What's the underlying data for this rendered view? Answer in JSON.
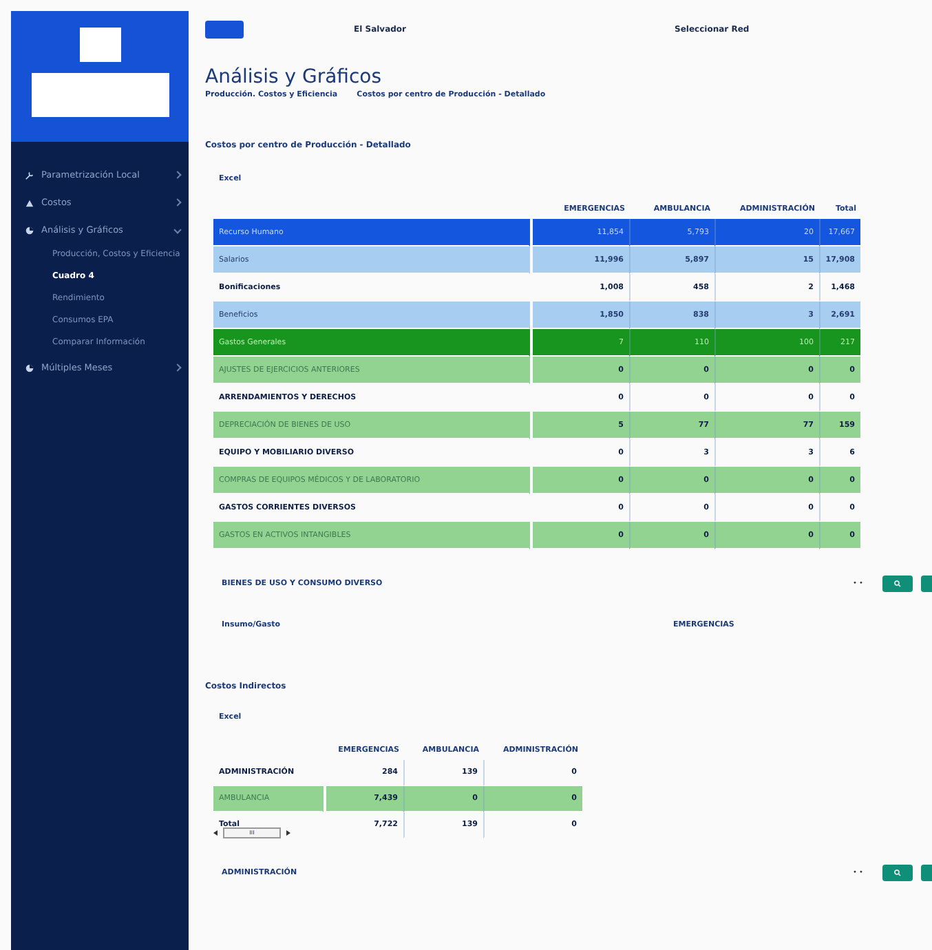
{
  "topbar": {
    "country": "El Salvador",
    "network": "Seleccionar Red"
  },
  "sidebar": {
    "items": [
      {
        "label": "Parametrización Local",
        "expanded": false
      },
      {
        "label": "Costos",
        "expanded": false
      },
      {
        "label": "Análisis y Gráficos",
        "expanded": true,
        "children": [
          {
            "label": "Producción, Costos y Eficiencia",
            "selected": false
          },
          {
            "label": "Cuadro 4",
            "selected": true
          },
          {
            "label": "Rendimiento",
            "selected": false
          },
          {
            "label": "Consumos EPA",
            "selected": false
          },
          {
            "label": "Comparar Información",
            "selected": false
          }
        ]
      },
      {
        "label": "Múltiples Meses",
        "expanded": false
      }
    ]
  },
  "page": {
    "title": "Análisis y Gráficos",
    "breadcrumb": [
      "Producción. Costos y Eficiencia",
      "Costos por centro de Producción - Detallado"
    ]
  },
  "detail": {
    "title": "Costos por centro de Producción - Detallado",
    "export": "Excel",
    "columns": [
      "EMERGENCIAS",
      "AMBULANCIA",
      "ADMINISTRACIÓN",
      "Total"
    ],
    "rows": [
      {
        "kind": "main",
        "label": "Recurso Humano",
        "cells": [
          "11,854",
          "5,793",
          "20",
          "17,667"
        ]
      },
      {
        "kind": "group",
        "label": "Salarios",
        "cells": [
          "11,996",
          "5,897",
          "15",
          "17,908"
        ]
      },
      {
        "kind": "item",
        "label": "Bonificaciones",
        "cells": [
          "1,008",
          "458",
          "2",
          "1,468"
        ]
      },
      {
        "kind": "group",
        "label": "Beneficios",
        "cells": [
          "1,850",
          "838",
          "3",
          "2,691"
        ]
      },
      {
        "kind": "main-green",
        "label": "Gastos Generales",
        "cells": [
          "7",
          "110",
          "100",
          "217"
        ]
      },
      {
        "kind": "green",
        "label": "AJUSTES DE EJERCICIOS ANTERIORES",
        "cells": [
          "0",
          "0",
          "0",
          "0"
        ]
      },
      {
        "kind": "item",
        "label": "ARRENDAMIENTOS Y DERECHOS",
        "cells": [
          "0",
          "0",
          "0",
          "0"
        ]
      },
      {
        "kind": "green",
        "label": "DEPRECIACIÓN DE BIENES DE USO",
        "cells": [
          "5",
          "77",
          "77",
          "159"
        ]
      },
      {
        "kind": "item",
        "label": "EQUIPO Y MOBILIARIO DIVERSO",
        "cells": [
          "0",
          "3",
          "3",
          "6"
        ]
      },
      {
        "kind": "green",
        "label": "COMPRAS DE EQUIPOS MÉDICOS Y DE LABORATORIO",
        "cells": [
          "0",
          "0",
          "0",
          "0"
        ]
      },
      {
        "kind": "item",
        "label": "GASTOS CORRIENTES DIVERSOS",
        "cells": [
          "0",
          "0",
          "0",
          "0"
        ]
      },
      {
        "kind": "green",
        "label": "GASTOS EN ACTIVOS INTANGIBLES",
        "cells": [
          "0",
          "0",
          "0",
          "0"
        ]
      }
    ]
  },
  "section1": {
    "title": "BIENES DE USO Y CONSUMO DIVERSO",
    "dots": "• •",
    "col_label": "Insumo/Gasto",
    "col_value": "EMERGENCIAS"
  },
  "indirect": {
    "title": "Costos Indirectos",
    "export": "Excel",
    "columns": [
      "EMERGENCIAS",
      "AMBULANCIA",
      "ADMINISTRACIÓN"
    ],
    "rows": [
      {
        "kind": "item",
        "label": "ADMINISTRACIÓN",
        "cells": [
          "284",
          "139",
          "0"
        ]
      },
      {
        "kind": "green",
        "label": "AMBULANCIA",
        "cells": [
          "7,439",
          "0",
          "0"
        ]
      },
      {
        "kind": "item",
        "label": "Total",
        "cells": [
          "7,722",
          "139",
          "0"
        ]
      }
    ],
    "scroll_grip": "III"
  },
  "section2": {
    "title": "ADMINISTRACIÓN",
    "dots": "• •"
  }
}
